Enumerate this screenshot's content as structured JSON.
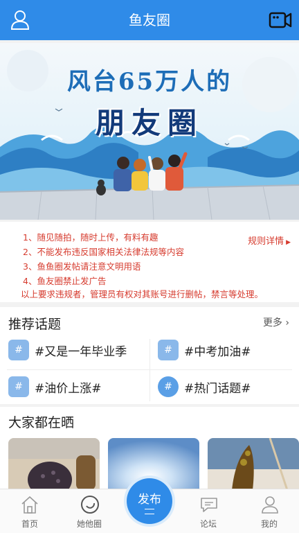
{
  "header": {
    "title": "鱼友圈",
    "left_icon": "user-icon",
    "right_icon": "video-camera-icon"
  },
  "banner": {
    "headline_1": "风台65万人的",
    "headline_2": "朋友圈"
  },
  "rules": {
    "lines": [
      "1、随见随拍，随时上传，有料有趣",
      "2、不能发布违反国家相关法律法规等内容",
      "3、鱼鱼圈发帖请注意文明用语",
      "4、鱼友圈禁止发广告",
      "以上要求违规者，管理员有权对其账号进行删帖，禁言等处理。"
    ],
    "detail_link": "规则详情"
  },
  "topics": {
    "title": "推荐话题",
    "more": "更多",
    "items": [
      {
        "label": "#又是一年毕业季",
        "icon": "hash-chat-icon"
      },
      {
        "label": "#中考加油#",
        "icon": "hash-chat-icon"
      },
      {
        "label": "#油价上涨#",
        "icon": "hash-chat-icon"
      },
      {
        "label": "#热门话题#",
        "icon": "hash-bubble-icon"
      }
    ]
  },
  "share": {
    "title": "大家都在晒"
  },
  "nav": {
    "items": [
      {
        "label": "首页",
        "icon": "home-icon"
      },
      {
        "label": "她他圈",
        "icon": "circle-icon"
      },
      {
        "label": "论坛",
        "icon": "chat-bubble-icon"
      },
      {
        "label": "我的",
        "icon": "person-icon"
      }
    ],
    "publish": "发布"
  },
  "colors": {
    "brand": "#2f8be8",
    "rules_red": "#d63b2e"
  }
}
